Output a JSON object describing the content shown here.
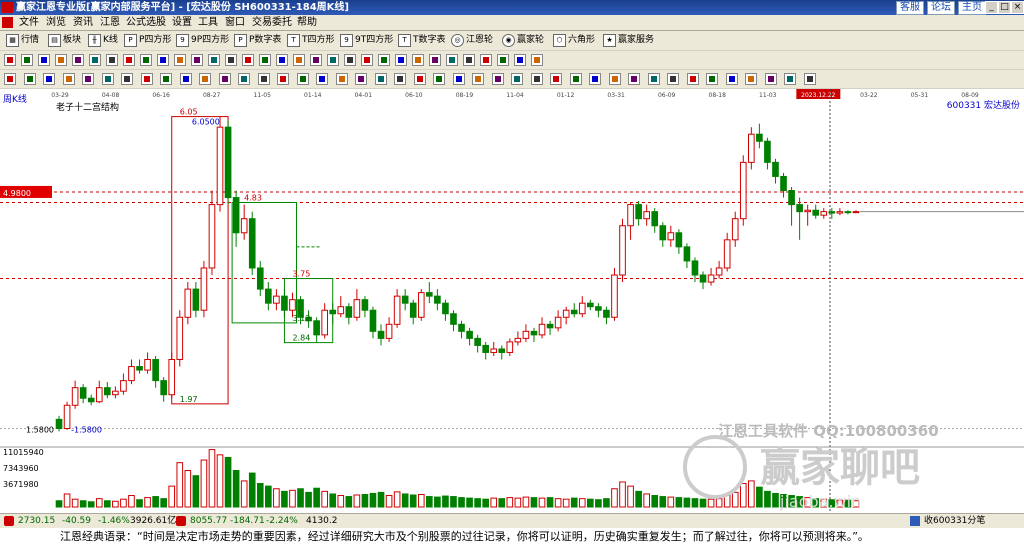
{
  "window": {
    "title": "赢家江恩专业版[赢家内部服务平台] - [宏达股份  SH600331-184周K线]",
    "links": [
      "客服",
      "论坛",
      "主页"
    ]
  },
  "menu": [
    "文件",
    "浏览",
    "资讯",
    "江恩",
    "公式选股",
    "设置",
    "工具",
    "窗口",
    "交易委托",
    "帮助"
  ],
  "toolbar1": [
    {
      "label": "行情",
      "icon": "grid-icon"
    },
    {
      "label": "板块",
      "icon": "sector-icon"
    },
    {
      "label": "K线",
      "icon": "kline-icon"
    },
    {
      "label": "P四方形",
      "icon": "p-square-icon"
    },
    {
      "label": "9P四方形",
      "icon": "9p-square-icon"
    },
    {
      "label": "P数字表",
      "icon": "p-table-icon"
    },
    {
      "label": "T四方形",
      "icon": "t-square-icon"
    },
    {
      "label": "9T四方形",
      "icon": "9t-square-icon"
    },
    {
      "label": "T数字表",
      "icon": "t-table-icon"
    },
    {
      "label": "江恩轮",
      "icon": "gann-wheel-icon"
    },
    {
      "label": "赢家轮",
      "icon": "winner-wheel-icon"
    },
    {
      "label": "六角形",
      "icon": "hexagon-icon"
    },
    {
      "label": "赢家服务",
      "icon": "service-icon"
    }
  ],
  "toolbar2_icon_count": 32,
  "toolbar3_icon_count": 42,
  "chart": {
    "period_label": "周K线",
    "structure_label": "老子十二宫结构",
    "stock": "600331  宏达股份",
    "date_ticks": [
      "03-29",
      "04-08",
      "06-16",
      "08-27",
      "11-05",
      "01-14",
      "04-01",
      "06-10",
      "08-19",
      "11-04",
      "01-12",
      "03-31",
      "06-09",
      "08-18",
      "11-03",
      "2023.12.22",
      "03-22",
      "05-31",
      "08-09"
    ],
    "price_box_left": "4.9800",
    "price_box_left_low": "1.5800",
    "annotations": [
      "6.05",
      "6.0500",
      "4.83",
      "3.75",
      "3.12",
      "2.84",
      "1.97",
      "1.5800"
    ],
    "volume_labels": [
      "11015940",
      "7343960",
      "3671980"
    ],
    "watermark": [
      "江恩工具软件 QQ:100800360",
      "赢家聊吧",
      "jiaoba.win"
    ],
    "colors": {
      "up": "#d00000",
      "down": "#008000",
      "background": "#ffffff"
    }
  },
  "chart_data": {
    "type": "candlestick",
    "title": "宏达股份 周K线",
    "xlabel": "",
    "ylabel": "",
    "ylim": [
      1.4,
      6.3
    ],
    "x": [
      "03-29",
      "03-29",
      "04-08",
      "04-08",
      "04-08",
      "04-08",
      "04-08",
      "04-08",
      "06-16",
      "06-16",
      "06-16",
      "06-16",
      "06-16",
      "06-16",
      "08-27",
      "08-27",
      "08-27",
      "08-27",
      "08-27",
      "08-27",
      "08-27",
      "08-27",
      "11-05",
      "11-05",
      "11-05",
      "11-05",
      "11-05",
      "11-05",
      "01-14",
      "01-14",
      "01-14",
      "01-14",
      "01-14",
      "01-14",
      "01-14",
      "01-14",
      "04-01",
      "04-01",
      "04-01",
      "04-01",
      "04-01",
      "04-01",
      "06-10",
      "06-10",
      "06-10",
      "06-10",
      "06-10",
      "06-10",
      "06-10",
      "06-10",
      "08-19",
      "08-19",
      "08-19",
      "08-19",
      "08-19",
      "08-19",
      "08-19",
      "08-19",
      "11-04",
      "11-04",
      "11-04",
      "11-04",
      "11-04",
      "11-04",
      "11-04",
      "01-12",
      "01-12",
      "01-12",
      "01-12",
      "01-12",
      "01-12",
      "01-12",
      "03-31",
      "03-31",
      "03-31",
      "03-31",
      "03-31",
      "03-31",
      "03-31",
      "06-09",
      "06-09",
      "06-09",
      "06-09",
      "06-09",
      "06-09",
      "06-09",
      "08-18",
      "08-18",
      "08-18",
      "08-18",
      "08-18",
      "08-18",
      "11-03",
      "11-03",
      "11-03",
      "11-03",
      "11-03",
      "11-03",
      "11-03",
      "11-03"
    ],
    "series": [
      {
        "candles": [
          [
            1.75,
            1.62,
            1.8,
            1.58
          ],
          [
            1.62,
            1.95,
            2.0,
            1.6
          ],
          [
            1.95,
            2.2,
            2.3,
            1.9
          ],
          [
            2.2,
            2.05,
            2.25,
            1.98
          ],
          [
            2.05,
            2.0,
            2.1,
            1.95
          ],
          [
            2.0,
            2.2,
            2.3,
            1.98
          ],
          [
            2.2,
            2.1,
            2.28,
            2.05
          ],
          [
            2.1,
            2.15,
            2.22,
            2.05
          ],
          [
            2.15,
            2.3,
            2.4,
            2.1
          ],
          [
            2.3,
            2.5,
            2.6,
            2.25
          ],
          [
            2.5,
            2.45,
            2.6,
            2.4
          ],
          [
            2.45,
            2.6,
            2.7,
            2.4
          ],
          [
            2.6,
            2.3,
            2.65,
            2.2
          ],
          [
            2.3,
            2.1,
            2.35,
            2.0
          ],
          [
            2.1,
            2.6,
            2.7,
            2.05
          ],
          [
            2.6,
            3.2,
            3.3,
            2.5
          ],
          [
            3.2,
            3.6,
            3.7,
            3.1
          ],
          [
            3.6,
            3.3,
            3.7,
            3.2
          ],
          [
            3.3,
            3.9,
            4.0,
            3.2
          ],
          [
            3.9,
            4.8,
            5.0,
            3.8
          ],
          [
            4.8,
            5.9,
            6.05,
            4.7
          ],
          [
            5.9,
            4.9,
            6.0,
            4.8
          ],
          [
            4.9,
            4.4,
            5.0,
            4.2
          ],
          [
            4.4,
            4.6,
            4.8,
            4.3
          ],
          [
            4.6,
            3.9,
            4.7,
            3.8
          ],
          [
            3.9,
            3.6,
            4.0,
            3.5
          ],
          [
            3.6,
            3.4,
            3.7,
            3.3
          ],
          [
            3.4,
            3.5,
            3.6,
            3.3
          ],
          [
            3.5,
            3.3,
            3.6,
            3.2
          ],
          [
            3.3,
            3.45,
            3.55,
            3.2
          ],
          [
            3.45,
            3.2,
            3.5,
            3.1
          ],
          [
            3.2,
            3.15,
            3.3,
            3.05
          ],
          [
            3.15,
            2.95,
            3.2,
            2.84
          ],
          [
            2.95,
            3.3,
            3.4,
            2.9
          ],
          [
            3.3,
            3.25,
            3.4,
            3.1
          ],
          [
            3.25,
            3.35,
            3.5,
            3.2
          ],
          [
            3.35,
            3.2,
            3.4,
            3.1
          ],
          [
            3.2,
            3.45,
            3.6,
            3.15
          ],
          [
            3.45,
            3.3,
            3.5,
            3.2
          ],
          [
            3.3,
            3.0,
            3.35,
            2.9
          ],
          [
            3.0,
            2.9,
            3.1,
            2.8
          ],
          [
            2.9,
            3.1,
            3.2,
            2.85
          ],
          [
            3.1,
            3.5,
            3.6,
            3.05
          ],
          [
            3.5,
            3.4,
            3.6,
            3.3
          ],
          [
            3.4,
            3.2,
            3.45,
            3.1
          ],
          [
            3.2,
            3.55,
            3.6,
            3.15
          ],
          [
            3.55,
            3.5,
            3.7,
            3.4
          ],
          [
            3.5,
            3.4,
            3.6,
            3.3
          ],
          [
            3.4,
            3.25,
            3.45,
            3.15
          ],
          [
            3.25,
            3.1,
            3.3,
            3.0
          ],
          [
            3.1,
            3.0,
            3.15,
            2.9
          ],
          [
            3.0,
            2.9,
            3.05,
            2.8
          ],
          [
            2.9,
            2.8,
            2.95,
            2.7
          ],
          [
            2.8,
            2.7,
            2.85,
            2.6
          ],
          [
            2.7,
            2.75,
            2.85,
            2.65
          ],
          [
            2.75,
            2.7,
            2.8,
            2.6
          ],
          [
            2.7,
            2.85,
            2.9,
            2.65
          ],
          [
            2.85,
            2.9,
            3.0,
            2.8
          ],
          [
            2.9,
            3.0,
            3.1,
            2.85
          ],
          [
            3.0,
            2.95,
            3.05,
            2.85
          ],
          [
            2.95,
            3.1,
            3.2,
            2.9
          ],
          [
            3.1,
            3.05,
            3.15,
            2.95
          ],
          [
            3.05,
            3.2,
            3.3,
            3.0
          ],
          [
            3.2,
            3.3,
            3.35,
            3.1
          ],
          [
            3.3,
            3.25,
            3.4,
            3.2
          ],
          [
            3.25,
            3.4,
            3.5,
            3.2
          ],
          [
            3.4,
            3.35,
            3.45,
            3.3
          ],
          [
            3.35,
            3.3,
            3.4,
            3.2
          ],
          [
            3.3,
            3.2,
            3.35,
            3.1
          ],
          [
            3.2,
            3.8,
            3.9,
            3.15
          ],
          [
            3.8,
            4.5,
            4.6,
            3.7
          ],
          [
            4.5,
            4.8,
            4.83,
            4.3
          ],
          [
            4.8,
            4.6,
            4.85,
            4.5
          ],
          [
            4.6,
            4.7,
            4.8,
            4.5
          ],
          [
            4.7,
            4.5,
            4.75,
            4.4
          ],
          [
            4.5,
            4.3,
            4.55,
            4.2
          ],
          [
            4.3,
            4.4,
            4.5,
            4.2
          ],
          [
            4.4,
            4.2,
            4.45,
            4.1
          ],
          [
            4.2,
            4.0,
            4.25,
            3.9
          ],
          [
            4.0,
            3.8,
            4.05,
            3.7
          ],
          [
            3.8,
            3.7,
            3.85,
            3.6
          ],
          [
            3.7,
            3.8,
            3.9,
            3.65
          ],
          [
            3.8,
            3.9,
            4.0,
            3.75
          ],
          [
            3.9,
            4.3,
            4.4,
            3.85
          ],
          [
            4.3,
            4.6,
            4.7,
            4.2
          ],
          [
            4.6,
            5.4,
            5.5,
            4.5
          ],
          [
            5.4,
            5.8,
            5.9,
            5.3
          ],
          [
            5.8,
            5.7,
            5.95,
            5.6
          ],
          [
            5.7,
            5.4,
            5.75,
            5.3
          ],
          [
            5.4,
            5.2,
            5.45,
            5.1
          ],
          [
            5.2,
            5.0,
            5.25,
            4.9
          ],
          [
            5.0,
            4.8,
            5.05,
            4.5
          ],
          [
            4.8,
            4.7,
            4.9,
            4.3
          ],
          [
            4.7,
            4.72,
            4.8,
            4.5
          ],
          [
            4.72,
            4.65,
            4.8,
            4.6
          ],
          [
            4.65,
            4.7,
            4.75,
            4.6
          ],
          [
            4.7,
            4.68,
            4.75,
            4.6
          ],
          [
            4.68,
            4.7,
            4.75,
            4.65
          ],
          [
            4.7,
            4.69,
            4.72,
            4.66
          ],
          [
            4.69,
            4.7,
            4.72,
            4.68
          ]
        ]
      },
      {
        "name": "VOL",
        "values": [
          1.2,
          2.5,
          1.5,
          1.2,
          1.0,
          1.6,
          1.2,
          1.1,
          1.5,
          2.2,
          1.4,
          1.8,
          2.0,
          1.6,
          4.0,
          8.5,
          7.0,
          6.0,
          9.0,
          11.0,
          10.0,
          9.5,
          7.0,
          5.0,
          6.5,
          4.5,
          4.0,
          3.5,
          3.0,
          3.2,
          3.5,
          2.8,
          3.6,
          3.0,
          2.5,
          2.2,
          2.0,
          2.3,
          2.4,
          2.6,
          2.8,
          2.2,
          2.9,
          2.5,
          2.3,
          2.4,
          2.0,
          1.9,
          2.1,
          2.0,
          1.8,
          1.7,
          1.6,
          1.5,
          1.7,
          1.6,
          1.8,
          1.7,
          1.9,
          1.8,
          1.7,
          1.8,
          1.6,
          1.5,
          1.7,
          1.6,
          1.5,
          1.4,
          1.6,
          3.5,
          4.8,
          4.0,
          3.0,
          2.5,
          2.2,
          2.0,
          1.9,
          1.8,
          1.7,
          1.6,
          1.5,
          1.5,
          1.6,
          2.2,
          2.8,
          4.5,
          5.0,
          3.8,
          3.0,
          2.6,
          2.4,
          2.2,
          2.0,
          1.8,
          1.6,
          1.5,
          1.4,
          1.3,
          1.3,
          1.2
        ]
      }
    ],
    "y_labels": [
      "4.9800",
      "1.5800"
    ],
    "annotations": [
      {
        "x": "08-27",
        "y": 6.05,
        "label": "6.05"
      },
      {
        "x": "11-05",
        "y": 4.83,
        "label": "4.83"
      },
      {
        "x": "01-14",
        "y": 3.75,
        "label": "3.75"
      },
      {
        "x": "01-14",
        "y": 3.12,
        "label": "3.12"
      },
      {
        "x": "01-14",
        "y": 2.84,
        "label": "2.84"
      },
      {
        "x": "08-27",
        "y": 1.97,
        "label": "1.97"
      }
    ]
  },
  "status": {
    "sh_index": "2730.15",
    "sh_change": "-40.59",
    "sh_pct": "-1.46%",
    "sh_amount": "3926.61亿",
    "sz_index": "8055.77",
    "sz_change": "-184.71",
    "sz_pct": "-2.24%",
    "sz_amount": "4130.2",
    "msg": "收600331分笔"
  },
  "quote": "江恩经典语录：“时间是决定市场走势的重要因素，经过详细研究大市及个别股票的过往记录，你将可以证明，历史确实重复发生；而了解过往，你将可以预测将来。”。"
}
